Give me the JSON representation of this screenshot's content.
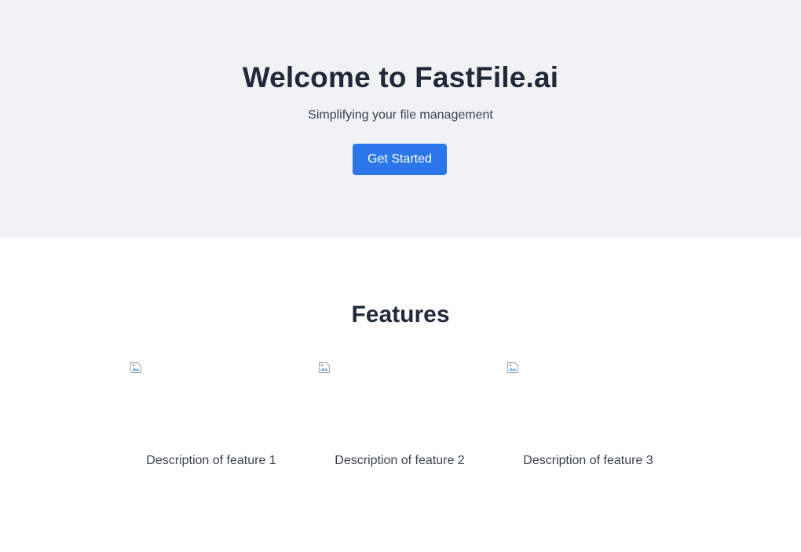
{
  "hero": {
    "title": "Welcome to FastFile.ai",
    "subtitle": "Simplifying your file management",
    "cta_label": "Get Started"
  },
  "features": {
    "title": "Features",
    "items": [
      {
        "icon": "broken-image-icon",
        "description": "Description of feature 1"
      },
      {
        "icon": "broken-image-icon",
        "description": "Description of feature 2"
      },
      {
        "icon": "broken-image-icon",
        "description": "Description of feature 3"
      }
    ]
  },
  "colors": {
    "hero_background": "#f0f2f5",
    "cta_background": "#2b77ea",
    "heading_text": "#1f2937",
    "body_text": "#374151"
  }
}
